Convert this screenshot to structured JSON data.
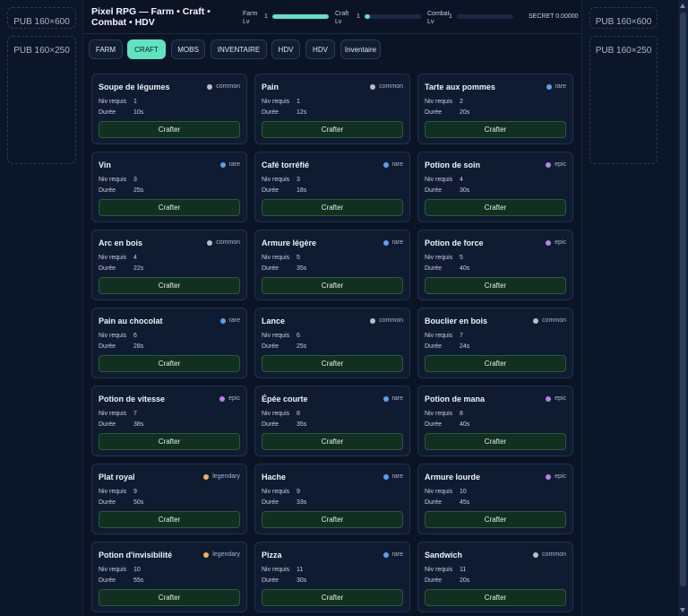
{
  "ads": {
    "left_top": "PUB 160×600",
    "left_bottom": "PUB 160×250",
    "right_top": "PUB 160×600",
    "right_bottom": "PUB 160×250"
  },
  "header": {
    "title": "Pixel RPG — Farm • Craft • Combat • HDV",
    "stats": [
      {
        "label": "Farm Lv",
        "level": "1",
        "progress": 1.0
      },
      {
        "label": "Craft Lv",
        "level": "1",
        "progress": 0.1
      },
      {
        "label": "Combat Lv",
        "level": "1",
        "progress": 0.0
      }
    ],
    "secret": "SECRET 0.00000"
  },
  "tabs": [
    {
      "label": "FARM",
      "active": false
    },
    {
      "label": "CRAFT",
      "active": true
    },
    {
      "label": "MOBS",
      "active": false
    },
    {
      "label": "INVENTAIRE",
      "active": false
    },
    {
      "label": "HDV",
      "active": false
    },
    {
      "label": "HDV",
      "active": false
    },
    {
      "label": "Inventaire",
      "active": false
    }
  ],
  "labels": {
    "level": "Niv requis",
    "duration": "Durée",
    "craft_button": "Crafter"
  },
  "rarity_colors": {
    "common": "#b8c0cc",
    "rare": "#5aa2f0",
    "epic": "#c07cf0",
    "legendary": "#f0b35a"
  },
  "recipes": [
    {
      "name": "Soupe de légumes",
      "rarity": "common",
      "level": "1",
      "duration": "10s"
    },
    {
      "name": "Pain",
      "rarity": "common",
      "level": "1",
      "duration": "12s"
    },
    {
      "name": "Tarte aux pommes",
      "rarity": "rare",
      "level": "2",
      "duration": "20s"
    },
    {
      "name": "Vin",
      "rarity": "rare",
      "level": "3",
      "duration": "25s"
    },
    {
      "name": "Café torréfié",
      "rarity": "rare",
      "level": "3",
      "duration": "18s"
    },
    {
      "name": "Potion de soin",
      "rarity": "epic",
      "level": "4",
      "duration": "30s"
    },
    {
      "name": "Arc en bois",
      "rarity": "common",
      "level": "4",
      "duration": "22s"
    },
    {
      "name": "Armure légère",
      "rarity": "rare",
      "level": "5",
      "duration": "35s"
    },
    {
      "name": "Potion de force",
      "rarity": "epic",
      "level": "5",
      "duration": "40s"
    },
    {
      "name": "Pain au chocolat",
      "rarity": "rare",
      "level": "6",
      "duration": "28s"
    },
    {
      "name": "Lance",
      "rarity": "common",
      "level": "6",
      "duration": "25s"
    },
    {
      "name": "Bouclier en bois",
      "rarity": "common",
      "level": "7",
      "duration": "24s"
    },
    {
      "name": "Potion de vitesse",
      "rarity": "epic",
      "level": "7",
      "duration": "38s"
    },
    {
      "name": "Épée courte",
      "rarity": "rare",
      "level": "8",
      "duration": "35s"
    },
    {
      "name": "Potion de mana",
      "rarity": "epic",
      "level": "8",
      "duration": "40s"
    },
    {
      "name": "Plat royal",
      "rarity": "legendary",
      "level": "9",
      "duration": "50s"
    },
    {
      "name": "Hache",
      "rarity": "rare",
      "level": "9",
      "duration": "33s"
    },
    {
      "name": "Armure lourde",
      "rarity": "epic",
      "level": "10",
      "duration": "45s"
    },
    {
      "name": "Potion d'invisibilité",
      "rarity": "legendary",
      "level": "10",
      "duration": "55s"
    },
    {
      "name": "Pizza",
      "rarity": "rare",
      "level": "11",
      "duration": "30s"
    },
    {
      "name": "Sandwich",
      "rarity": "common",
      "level": "11",
      "duration": "20s"
    }
  ]
}
